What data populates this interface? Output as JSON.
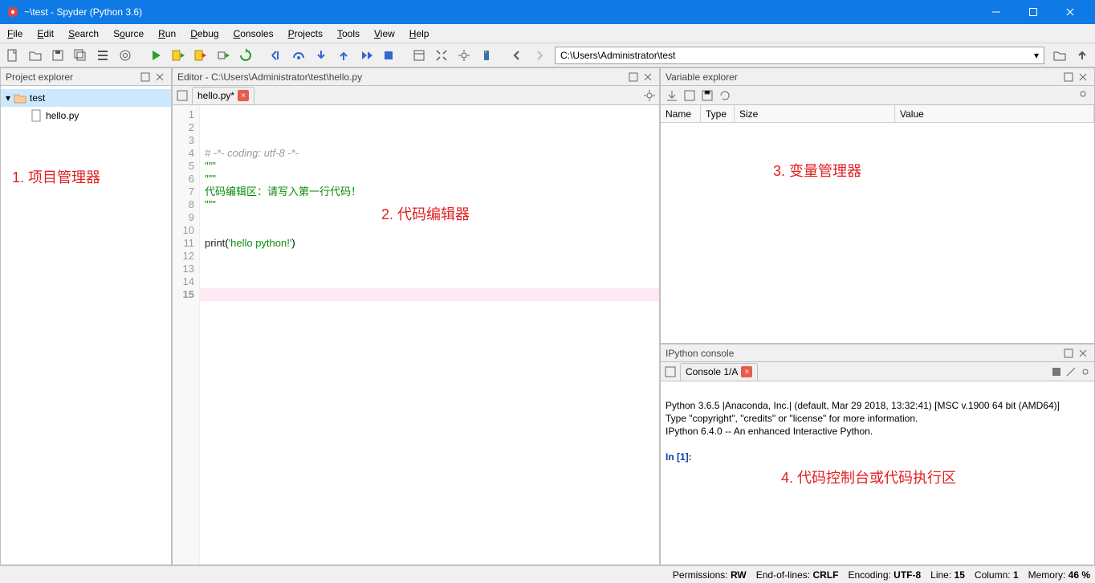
{
  "window": {
    "title": "~\\test - Spyder (Python 3.6)"
  },
  "menu": [
    "File",
    "Edit",
    "Search",
    "Source",
    "Run",
    "Debug",
    "Consoles",
    "Projects",
    "Tools",
    "View",
    "Help"
  ],
  "toolbar": {
    "path": "C:\\Users\\Administrator\\test"
  },
  "panes": {
    "project_explorer": {
      "title": "Project explorer",
      "root": "test",
      "files": [
        "hello.py"
      ]
    },
    "editor": {
      "title": "Editor - C:\\Users\\Administrator\\test\\hello.py",
      "tab": "hello.py*",
      "lines": [
        "# -*- coding: utf-8 -*-",
        "\"\"\"",
        "\"\"\"",
        "代码编辑区：请写入第一行代码！",
        "\"\"\"",
        "",
        "",
        "print('hello python!')",
        "",
        "",
        "",
        "",
        "",
        "",
        ""
      ],
      "current_line": 15
    },
    "variable_explorer": {
      "title": "Variable explorer",
      "columns": [
        "Name",
        "Type",
        "Size",
        "Value"
      ]
    },
    "console": {
      "title": "IPython console",
      "tab": "Console 1/A",
      "banner1": "Python 3.6.5 |Anaconda, Inc.| (default, Mar 29 2018, 13:32:41) [MSC v.1900 64 bit (AMD64)]",
      "banner2": "Type \"copyright\", \"credits\" or \"license\" for more information.",
      "banner3": "IPython 6.4.0 -- An enhanced Interactive Python.",
      "prompt": "In [1]:"
    }
  },
  "annotations": {
    "a1": "1. 项目管理器",
    "a2": "2. 代码编辑器",
    "a3": "3. 变量管理器",
    "a4": "4. 代码控制台或代码执行区"
  },
  "status": {
    "permissions_label": "Permissions:",
    "permissions": "RW",
    "eol_label": "End-of-lines:",
    "eol": "CRLF",
    "encoding_label": "Encoding:",
    "encoding": "UTF-8",
    "line_label": "Line:",
    "line": "15",
    "col_label": "Column:",
    "col": "1",
    "mem_label": "Memory:",
    "mem": "46 %"
  }
}
